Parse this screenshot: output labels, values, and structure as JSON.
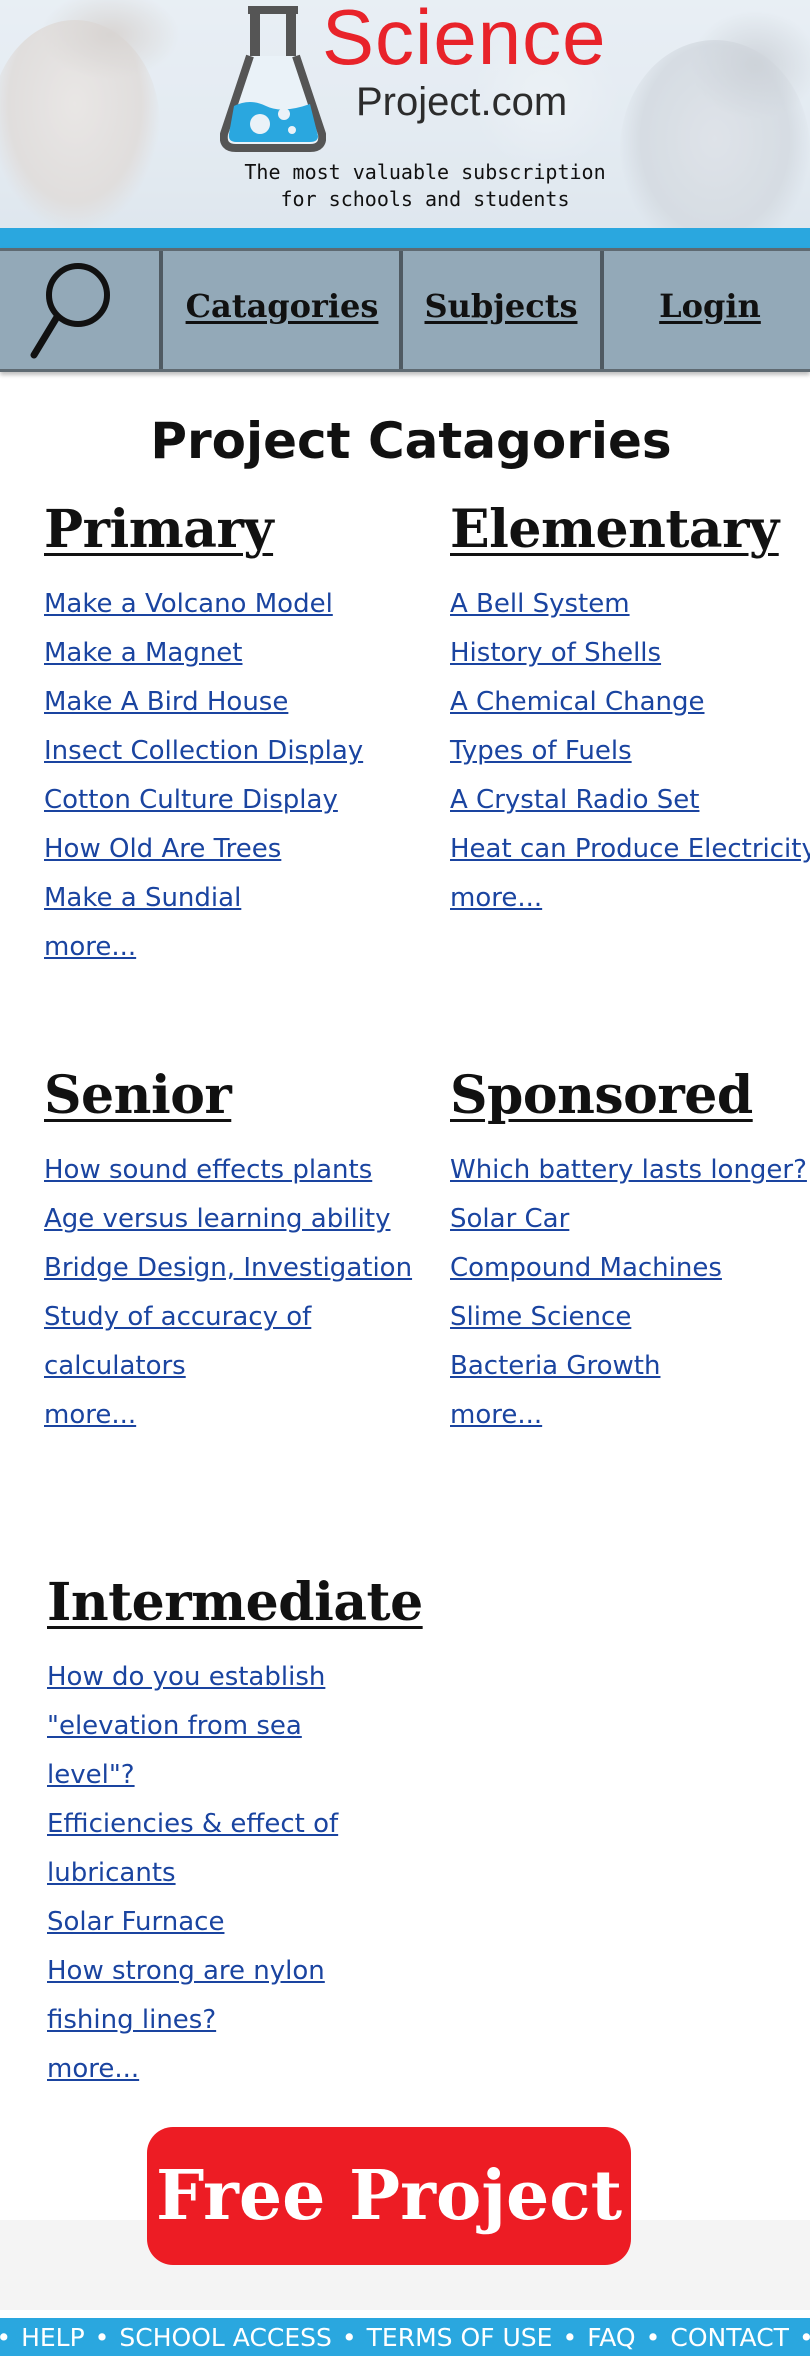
{
  "brand": {
    "name": "Science",
    "domain": "Project.com",
    "tagline_line1": "The most valuable subscription",
    "tagline_line2": "for schools and students"
  },
  "nav": {
    "search_icon": "magnifier-icon",
    "items": [
      {
        "label": "Catagories"
      },
      {
        "label": "Subjects"
      },
      {
        "label": "Login"
      }
    ]
  },
  "page_title": "Project Catagories",
  "sections": {
    "primary": {
      "title": "Primary",
      "links": [
        "Make a Volcano Model",
        "Make a Magnet",
        "Make A Bird House",
        "Insect Collection Display",
        "Cotton Culture Display",
        "How Old Are Trees",
        "Make a Sundial"
      ],
      "more": "more..."
    },
    "elementary": {
      "title": "Elementary",
      "links": [
        "A Bell System ",
        "History of Shells ",
        "A Chemical Change ",
        "Types of Fuels",
        "A Crystal Radio Set ",
        "Heat can Produce Electricity "
      ],
      "more": "more..."
    },
    "senior": {
      "title": "Senior",
      "links": [
        "How sound effects plants",
        "Age versus learning ability ",
        "Bridge Design, Investigation",
        "Study of accuracy of calculators"
      ],
      "more": "more..."
    },
    "sponsored": {
      "title": "Sponsored",
      "links": [
        "Which battery lasts longer?",
        "Solar Car",
        "Compound Machines",
        "Slime Science",
        "Bacteria Growth"
      ],
      "more": "more..."
    },
    "intermediate": {
      "title": "Intermediate",
      "links": [
        "How do you establish \"elevation from sea level\"?",
        "Efficiencies & effect of lubricants",
        "Solar Furnace",
        "How strong are nylon fishing lines?"
      ],
      "more": "more..."
    }
  },
  "cta": {
    "label": "Free Project"
  },
  "footer": {
    "links": [
      "HELP",
      "SCHOOL ACCESS",
      "TERMS OF USE",
      "FAQ",
      "CONTACT"
    ],
    "separator": "•"
  },
  "colors": {
    "brand_red": "#e8232a",
    "accent_blue": "#2aa7df",
    "nav_gray": "#93a9b8",
    "link_blue": "#1a44a0",
    "cta_red": "#ed1c24"
  }
}
